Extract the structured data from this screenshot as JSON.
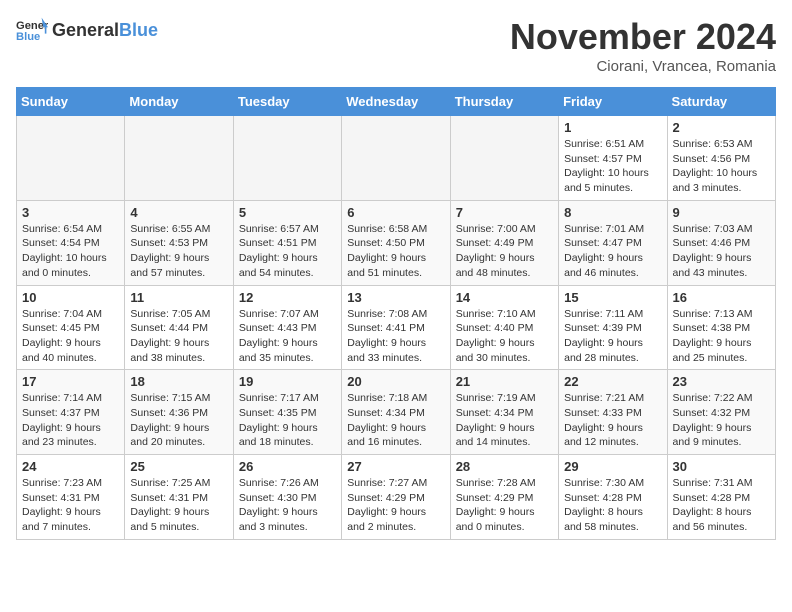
{
  "header": {
    "logo_general": "General",
    "logo_blue": "Blue",
    "month_title": "November 2024",
    "subtitle": "Ciorani, Vrancea, Romania"
  },
  "days_of_week": [
    "Sunday",
    "Monday",
    "Tuesday",
    "Wednesday",
    "Thursday",
    "Friday",
    "Saturday"
  ],
  "weeks": [
    [
      {
        "day": "",
        "empty": true
      },
      {
        "day": "",
        "empty": true
      },
      {
        "day": "",
        "empty": true
      },
      {
        "day": "",
        "empty": true
      },
      {
        "day": "",
        "empty": true
      },
      {
        "day": "1",
        "sunrise": "6:51 AM",
        "sunset": "4:57 PM",
        "daylight": "10 hours and 5 minutes."
      },
      {
        "day": "2",
        "sunrise": "6:53 AM",
        "sunset": "4:56 PM",
        "daylight": "10 hours and 3 minutes."
      }
    ],
    [
      {
        "day": "3",
        "sunrise": "6:54 AM",
        "sunset": "4:54 PM",
        "daylight": "10 hours and 0 minutes."
      },
      {
        "day": "4",
        "sunrise": "6:55 AM",
        "sunset": "4:53 PM",
        "daylight": "9 hours and 57 minutes."
      },
      {
        "day": "5",
        "sunrise": "6:57 AM",
        "sunset": "4:51 PM",
        "daylight": "9 hours and 54 minutes."
      },
      {
        "day": "6",
        "sunrise": "6:58 AM",
        "sunset": "4:50 PM",
        "daylight": "9 hours and 51 minutes."
      },
      {
        "day": "7",
        "sunrise": "7:00 AM",
        "sunset": "4:49 PM",
        "daylight": "9 hours and 48 minutes."
      },
      {
        "day": "8",
        "sunrise": "7:01 AM",
        "sunset": "4:47 PM",
        "daylight": "9 hours and 46 minutes."
      },
      {
        "day": "9",
        "sunrise": "7:03 AM",
        "sunset": "4:46 PM",
        "daylight": "9 hours and 43 minutes."
      }
    ],
    [
      {
        "day": "10",
        "sunrise": "7:04 AM",
        "sunset": "4:45 PM",
        "daylight": "9 hours and 40 minutes."
      },
      {
        "day": "11",
        "sunrise": "7:05 AM",
        "sunset": "4:44 PM",
        "daylight": "9 hours and 38 minutes."
      },
      {
        "day": "12",
        "sunrise": "7:07 AM",
        "sunset": "4:43 PM",
        "daylight": "9 hours and 35 minutes."
      },
      {
        "day": "13",
        "sunrise": "7:08 AM",
        "sunset": "4:41 PM",
        "daylight": "9 hours and 33 minutes."
      },
      {
        "day": "14",
        "sunrise": "7:10 AM",
        "sunset": "4:40 PM",
        "daylight": "9 hours and 30 minutes."
      },
      {
        "day": "15",
        "sunrise": "7:11 AM",
        "sunset": "4:39 PM",
        "daylight": "9 hours and 28 minutes."
      },
      {
        "day": "16",
        "sunrise": "7:13 AM",
        "sunset": "4:38 PM",
        "daylight": "9 hours and 25 minutes."
      }
    ],
    [
      {
        "day": "17",
        "sunrise": "7:14 AM",
        "sunset": "4:37 PM",
        "daylight": "9 hours and 23 minutes."
      },
      {
        "day": "18",
        "sunrise": "7:15 AM",
        "sunset": "4:36 PM",
        "daylight": "9 hours and 20 minutes."
      },
      {
        "day": "19",
        "sunrise": "7:17 AM",
        "sunset": "4:35 PM",
        "daylight": "9 hours and 18 minutes."
      },
      {
        "day": "20",
        "sunrise": "7:18 AM",
        "sunset": "4:34 PM",
        "daylight": "9 hours and 16 minutes."
      },
      {
        "day": "21",
        "sunrise": "7:19 AM",
        "sunset": "4:34 PM",
        "daylight": "9 hours and 14 minutes."
      },
      {
        "day": "22",
        "sunrise": "7:21 AM",
        "sunset": "4:33 PM",
        "daylight": "9 hours and 12 minutes."
      },
      {
        "day": "23",
        "sunrise": "7:22 AM",
        "sunset": "4:32 PM",
        "daylight": "9 hours and 9 minutes."
      }
    ],
    [
      {
        "day": "24",
        "sunrise": "7:23 AM",
        "sunset": "4:31 PM",
        "daylight": "9 hours and 7 minutes."
      },
      {
        "day": "25",
        "sunrise": "7:25 AM",
        "sunset": "4:31 PM",
        "daylight": "9 hours and 5 minutes."
      },
      {
        "day": "26",
        "sunrise": "7:26 AM",
        "sunset": "4:30 PM",
        "daylight": "9 hours and 3 minutes."
      },
      {
        "day": "27",
        "sunrise": "7:27 AM",
        "sunset": "4:29 PM",
        "daylight": "9 hours and 2 minutes."
      },
      {
        "day": "28",
        "sunrise": "7:28 AM",
        "sunset": "4:29 PM",
        "daylight": "9 hours and 0 minutes."
      },
      {
        "day": "29",
        "sunrise": "7:30 AM",
        "sunset": "4:28 PM",
        "daylight": "8 hours and 58 minutes."
      },
      {
        "day": "30",
        "sunrise": "7:31 AM",
        "sunset": "4:28 PM",
        "daylight": "8 hours and 56 minutes."
      }
    ]
  ],
  "labels": {
    "sunrise": "Sunrise:",
    "sunset": "Sunset:",
    "daylight": "Daylight:"
  }
}
